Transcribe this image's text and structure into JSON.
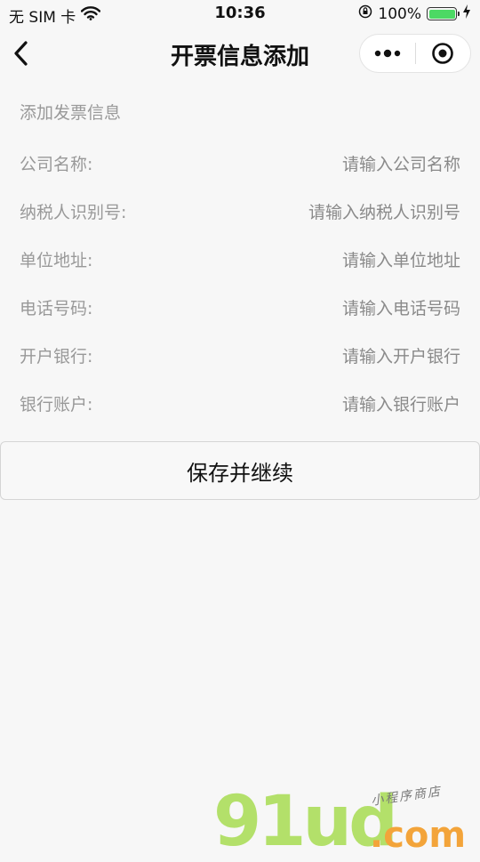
{
  "status_bar": {
    "carrier": "无 SIM 卡",
    "time": "10:36",
    "battery": "100%",
    "battery_level": 1.0
  },
  "nav": {
    "title": "开票信息添加"
  },
  "form": {
    "section_header": "添加发票信息",
    "fields": [
      {
        "label": "公司名称:",
        "placeholder": "请输入公司名称",
        "value": ""
      },
      {
        "label": "纳税人识别号:",
        "placeholder": "请输入纳税人识别号",
        "value": ""
      },
      {
        "label": "单位地址:",
        "placeholder": "请输入单位地址",
        "value": ""
      },
      {
        "label": "电话号码:",
        "placeholder": "请输入电话号码",
        "value": ""
      },
      {
        "label": "开户银行:",
        "placeholder": "请输入开户银行",
        "value": ""
      },
      {
        "label": "银行账户:",
        "placeholder": "请输入银行账户",
        "value": ""
      }
    ]
  },
  "actions": {
    "save_label": "保存并继续"
  },
  "watermark": {
    "logo": "91ud",
    "domain": ".com",
    "tagline": "小程序商店"
  },
  "colors": {
    "background": "#f7f7f7",
    "battery": "#4cd964",
    "watermark_logo": "#b3e06a",
    "watermark_domain": "#f3a43a"
  }
}
